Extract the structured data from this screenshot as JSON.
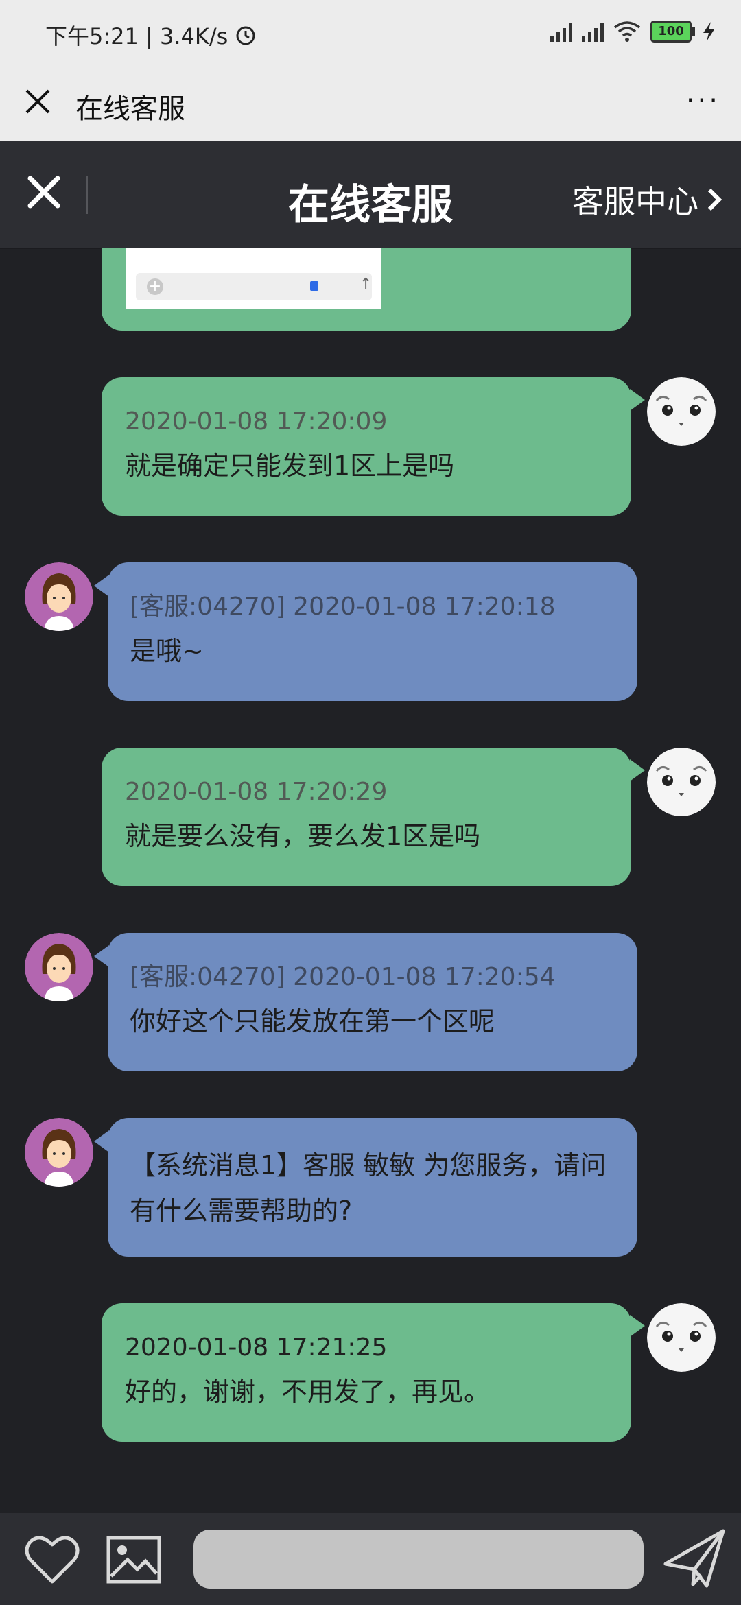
{
  "status_bar": {
    "time_speed": "下午5:21 | 3.4K/s",
    "battery": "100"
  },
  "nav_bar": {
    "title": "在线客服",
    "more": "···"
  },
  "chat_header": {
    "title": "在线客服",
    "service_center": "客服中心"
  },
  "messages": [
    {
      "side": "user",
      "meta": "2020-01-08 17:20:09",
      "text": "就是确定只能发到1区上是吗"
    },
    {
      "side": "agent",
      "meta": "[客服:04270] 2020-01-08 17:20:18",
      "text": "是哦~"
    },
    {
      "side": "user",
      "meta": "2020-01-08 17:20:29",
      "text": "就是要么没有，要么发1区是吗"
    },
    {
      "side": "agent",
      "meta": "[客服:04270] 2020-01-08 17:20:54",
      "text": "你好这个只能发放在第一个区呢"
    },
    {
      "side": "agent",
      "meta": "",
      "text": "【系统消息1】客服 敏敏 为您服务，请问有什么需要帮助的?"
    },
    {
      "side": "user",
      "meta": "2020-01-08 17:21:25",
      "text": "好的，谢谢，不用发了，再见。"
    }
  ],
  "colors": {
    "user_bubble": "#6dbb8d",
    "agent_bubble": "#6f8cc0",
    "background": "#202125",
    "header": "#2d2e33"
  },
  "icons": {
    "nav_close": "close-icon",
    "header_close": "close-icon",
    "header_chevron": "chevron-right-icon",
    "like": "heart-icon",
    "image": "image-icon",
    "send": "paper-plane-icon",
    "user_avatar": "seal-avatar",
    "agent_avatar": "agent-avatar"
  }
}
